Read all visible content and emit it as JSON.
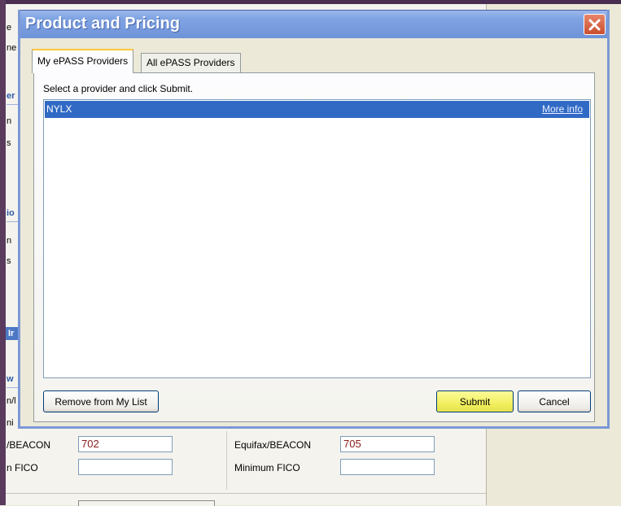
{
  "background": {
    "fragments": [
      "e",
      "ne",
      "er",
      "n",
      "s",
      "io",
      "n",
      "s",
      "Ir",
      "w",
      "n/l",
      "ni",
      "/BEACON",
      "n FICO"
    ],
    "fields": {
      "left_score_value": "702",
      "left_fico_value": "",
      "right_label": "Equifax/BEACON",
      "right_score_value": "705",
      "right_fico_label": "Minimum FICO",
      "right_fico_value": ""
    }
  },
  "dialog": {
    "title": "Product and Pricing",
    "close_icon": "close-x-icon",
    "tabs": [
      {
        "label": "My ePASS Providers",
        "active": true
      },
      {
        "label": "All ePASS Providers",
        "active": false
      }
    ],
    "instruction": "Select a provider and click Submit.",
    "providers": [
      {
        "name": "NYLX",
        "link": "More info",
        "selected": true
      }
    ],
    "buttons": {
      "remove": "Remove from My List",
      "submit": "Submit",
      "cancel": "Cancel"
    },
    "colors": {
      "title_bar": "#7fa3e2",
      "selection": "#316ac5",
      "close_button": "#c94e2e",
      "submit_button": "#f2f060"
    }
  }
}
